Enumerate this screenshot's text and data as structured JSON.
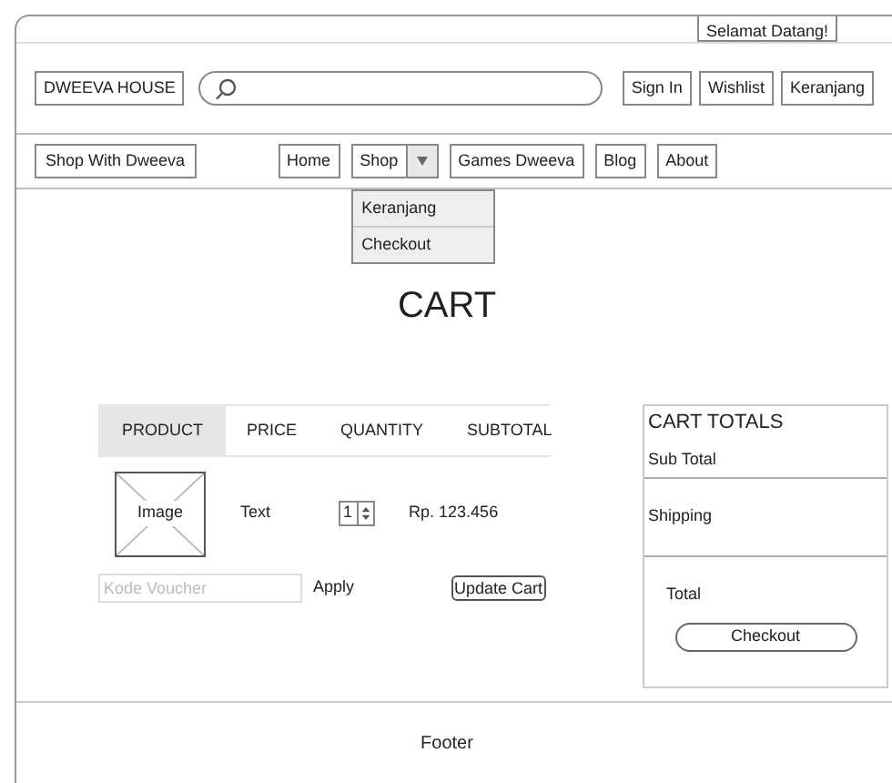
{
  "greeting": "Selamat Datang!",
  "brand": "DWEEVA HOUSE",
  "account_buttons": [
    "Sign In",
    "Wishlist",
    "Keranjang"
  ],
  "nav": {
    "label": "Shop With Dweeva",
    "items": [
      {
        "label": "Home",
        "kind": "link"
      },
      {
        "label": "Shop",
        "kind": "dropdown",
        "expanded": true,
        "menu": [
          "Keranjang",
          "Checkout"
        ]
      },
      {
        "label": "Games Dweeva",
        "kind": "link"
      },
      {
        "label": "Blog",
        "kind": "link"
      },
      {
        "label": "About",
        "kind": "link"
      }
    ]
  },
  "title": "CART",
  "table": {
    "columns": [
      {
        "label": "PRODUCT",
        "selected": true
      },
      {
        "label": "PRICE",
        "selected": false
      },
      {
        "label": "QUANTITY",
        "selected": false
      },
      {
        "label": "SUBTOTAL",
        "selected": false
      }
    ],
    "rows": [
      {
        "image": "Image",
        "price": "Text",
        "quantity": "1",
        "subtotal": "Rp. 123.456"
      }
    ]
  },
  "voucher": {
    "placeholder": "Kode Voucher",
    "apply": "Apply"
  },
  "update_button": "Update Cart",
  "totals": {
    "title": "CART TOTALS",
    "subtotal": "Sub Total",
    "shipping": "Shipping",
    "total": "Total",
    "checkout": "Checkout"
  },
  "footer": "Footer"
}
